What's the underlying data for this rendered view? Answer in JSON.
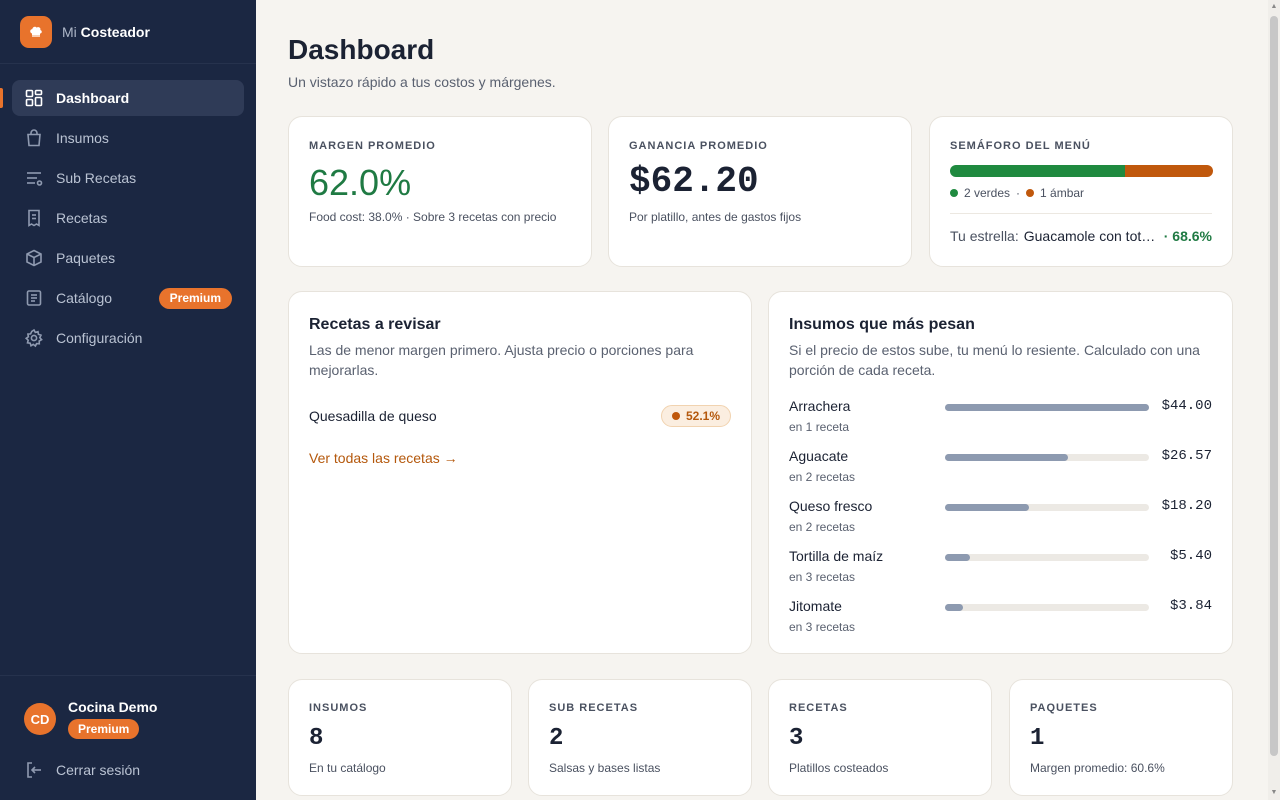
{
  "brand": {
    "prefix": "Mi",
    "name": "Costeador",
    "logo_icon": "chef-hat-icon",
    "accent": "#e8732c"
  },
  "sidebar": {
    "items": [
      {
        "label": "Dashboard",
        "icon": "grid-icon",
        "active": true
      },
      {
        "label": "Insumos",
        "icon": "bag-icon"
      },
      {
        "label": "Sub Recetas",
        "icon": "list-icon"
      },
      {
        "label": "Recetas",
        "icon": "receipt-icon"
      },
      {
        "label": "Paquetes",
        "icon": "box-icon"
      },
      {
        "label": "Catálogo",
        "icon": "catalog-icon",
        "badge": "Premium"
      },
      {
        "label": "Configuración",
        "icon": "gear-icon"
      }
    ],
    "user": {
      "initials": "CD",
      "name": "Cocina Demo",
      "badge": "Premium"
    },
    "logout_label": "Cerrar sesión"
  },
  "page": {
    "title": "Dashboard",
    "subtitle": "Un vistazo rápido a tus costos y márgenes."
  },
  "kpis": {
    "margin": {
      "label": "MARGEN PROMEDIO",
      "value": "62.0%",
      "note": "Food cost: 38.0% · Sobre 3 recetas con precio"
    },
    "profit": {
      "label": "GANANCIA PROMEDIO",
      "value": "$62.20",
      "note": "Por platillo, antes de gastos fijos"
    },
    "semaforo": {
      "label": "SEMÁFORO DEL MENÚ",
      "green_share": 0.667,
      "amber_share": 0.333,
      "green_color": "#1f8a3f",
      "amber_color": "#c0580c",
      "green_text": "2 verdes",
      "separator": "·",
      "amber_text": "1 ámbar",
      "star_label": "Tu estrella:",
      "star_name": "Guacamole con totopos",
      "star_pct": "· 68.6%"
    }
  },
  "review": {
    "title": "Recetas a revisar",
    "desc": "Las de menor margen primero. Ajusta precio o porciones para mejorarlas.",
    "items": [
      {
        "name": "Quesadilla de queso",
        "margin": "52.1%"
      }
    ],
    "see_all": "Ver todas las recetas →"
  },
  "heavy": {
    "title": "Insumos que más pesan",
    "desc": "Si el precio de estos sube, tu menú lo resiente. Calculado con una porción de cada receta.",
    "items": [
      {
        "name": "Arrachera",
        "sub": "en 1 receta",
        "amount": "$44.00",
        "value": 44.0
      },
      {
        "name": "Aguacate",
        "sub": "en 2 recetas",
        "amount": "$26.57",
        "value": 26.57
      },
      {
        "name": "Queso fresco",
        "sub": "en 2 recetas",
        "amount": "$18.20",
        "value": 18.2
      },
      {
        "name": "Tortilla de maíz",
        "sub": "en 3 recetas",
        "amount": "$5.40",
        "value": 5.4
      },
      {
        "name": "Jitomate",
        "sub": "en 3 recetas",
        "amount": "$3.84",
        "value": 3.84
      }
    ]
  },
  "stats": [
    {
      "label": "INSUMOS",
      "value": "8",
      "note": "En tu catálogo"
    },
    {
      "label": "SUB RECETAS",
      "value": "2",
      "note": "Salsas y bases listas"
    },
    {
      "label": "RECETAS",
      "value": "3",
      "note": "Platillos costeados"
    },
    {
      "label": "PAQUETES",
      "value": "1",
      "note": "Margen promedio: 60.6%"
    }
  ]
}
